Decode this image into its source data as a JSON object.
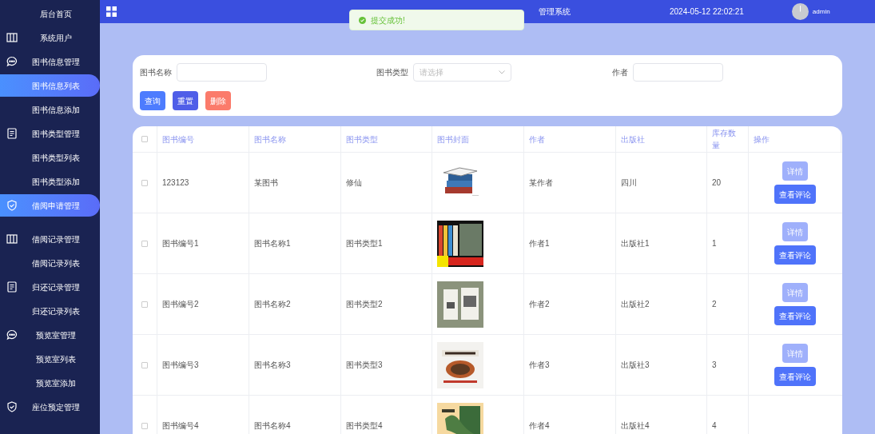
{
  "sidebar": {
    "items": [
      {
        "label": "后台首页",
        "kind": "link",
        "selected": false
      },
      {
        "label": "系统用户",
        "kind": "menu",
        "selected": false
      },
      {
        "label": "图书信息管理",
        "kind": "menu",
        "selected": false
      },
      {
        "label": "图书信息列表",
        "kind": "link",
        "selected": true
      },
      {
        "label": "图书信息添加",
        "kind": "link",
        "selected": false
      },
      {
        "label": "图书类型管理",
        "kind": "menu",
        "selected": false
      },
      {
        "label": "图书类型列表",
        "kind": "link",
        "selected": false
      },
      {
        "label": "图书类型添加",
        "kind": "link",
        "selected": false
      },
      {
        "label": "借阅申请管理",
        "kind": "menu",
        "selected": true
      },
      {
        "label": "借阅记录管理",
        "kind": "menu",
        "selected": false
      },
      {
        "label": "借阅记录列表",
        "kind": "link",
        "selected": false
      },
      {
        "label": "归还记录管理",
        "kind": "menu",
        "selected": false
      },
      {
        "label": "归还记录列表",
        "kind": "link",
        "selected": false
      },
      {
        "label": "预览室管理",
        "kind": "menu",
        "selected": false
      },
      {
        "label": "预览室列表",
        "kind": "link",
        "selected": false
      },
      {
        "label": "预览室添加",
        "kind": "link",
        "selected": false
      },
      {
        "label": "座位预定管理",
        "kind": "menu",
        "selected": false
      }
    ]
  },
  "header": {
    "title": "管理系统",
    "datetime": "2024-05-12 22:02:21",
    "user": "admin"
  },
  "toast": {
    "message": "提交成功!"
  },
  "search": {
    "fields": [
      {
        "label": "图书名称",
        "kind": "input"
      },
      {
        "label": "图书类型",
        "kind": "select",
        "placeholder": "请选择"
      },
      {
        "label": "作者",
        "kind": "input"
      }
    ],
    "buttons": [
      {
        "label": "查询",
        "kind": "primary"
      },
      {
        "label": "重置",
        "kind": "secondary"
      },
      {
        "label": "删除",
        "kind": "danger"
      }
    ]
  },
  "table": {
    "all_checked": false,
    "columns": [
      "图书编号",
      "图书名称",
      "图书类型",
      "图书封面",
      "作者",
      "出版社",
      "库存数量",
      "操作"
    ],
    "rows": [
      {
        "checked": false,
        "cells": [
          "123123",
          "某图书",
          "修仙"
        ],
        "cover": {
          "kind": "picture"
        },
        "author": "某作者",
        "publisher": "四川",
        "stock": "20",
        "actions": [
          "详情",
          "查看评论"
        ]
      },
      {
        "checked": false,
        "cells": [
          "图书编号1",
          "图书名称1",
          "图书类型1"
        ],
        "cover": {
          "kind": "picture"
        },
        "author": "作者1",
        "publisher": "出版社1",
        "stock": "1",
        "actions": [
          "详情",
          "查看评论"
        ]
      },
      {
        "checked": false,
        "cells": [
          "图书编号2",
          "图书名称2",
          "图书类型2"
        ],
        "cover": {
          "kind": "picture"
        },
        "author": "作者2",
        "publisher": "出版社2",
        "stock": "2",
        "actions": [
          "详情",
          "查看评论"
        ]
      },
      {
        "checked": false,
        "cells": [
          "图书编号3",
          "图书名称3",
          "图书类型3"
        ],
        "cover": {
          "kind": "picture"
        },
        "author": "作者3",
        "publisher": "出版社3",
        "stock": "3",
        "actions": [
          "详情",
          "查看评论"
        ]
      },
      {
        "checked": false,
        "cells": [
          "图书编号4",
          "图书名称4",
          "图书类型4"
        ],
        "cover": {
          "kind": "picture"
        },
        "author": "作者4",
        "publisher": "出版社4",
        "stock": "4",
        "actions": []
      }
    ]
  }
}
